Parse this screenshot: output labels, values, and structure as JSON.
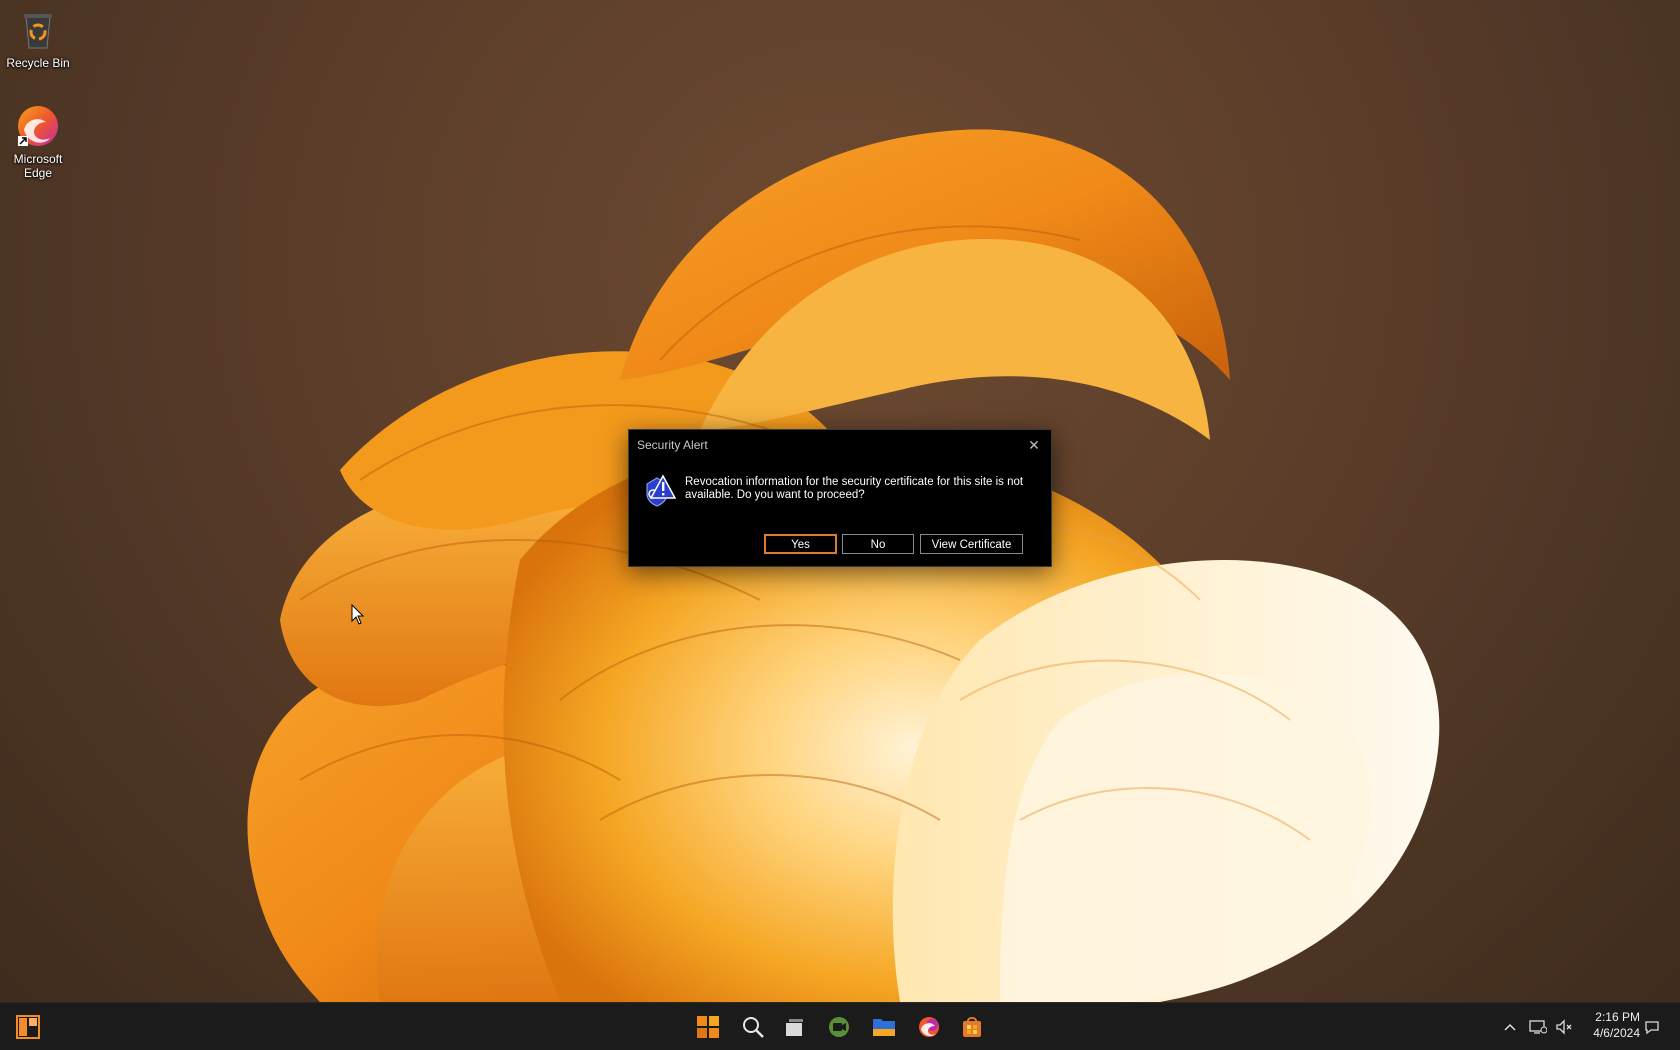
{
  "desktop": {
    "icons": [
      {
        "label": "Recycle Bin",
        "icon": "recycle-bin-icon"
      },
      {
        "label": "Microsoft Edge",
        "icon": "edge-icon"
      }
    ]
  },
  "dialog": {
    "title": "Security Alert",
    "close_glyph": "✕",
    "message": "Revocation information for the security certificate for this site is not available. Do you want to proceed?",
    "buttons": {
      "yes": "Yes",
      "no": "No",
      "view": "View Certificate"
    },
    "icon": "security-warning-icon"
  },
  "taskbar": {
    "left_icon": "widgets-icon",
    "pinned": [
      "start-icon",
      "search-icon",
      "task-view-icon",
      "meet-icon",
      "file-explorer-icon",
      "edge-icon",
      "store-icon"
    ],
    "tray": [
      "chevron-up-icon",
      "network-icon",
      "volume-muted-icon",
      "notification-icon"
    ],
    "time": "2:16 PM",
    "date": "4/6/2024"
  },
  "colors": {
    "accent": "#e07b2e",
    "wallpaper_primary": "#f5a623",
    "taskbar_bg": "#1b1b1b"
  }
}
